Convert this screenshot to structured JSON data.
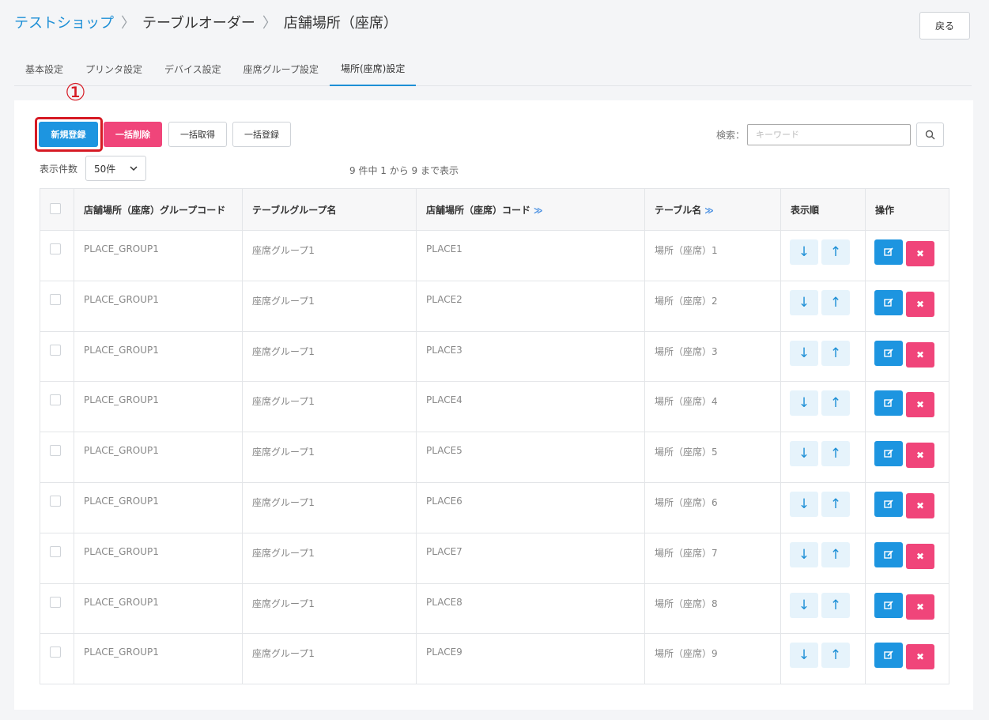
{
  "breadcrumb": {
    "shop": "テストショップ",
    "sep": ">",
    "section": "テーブルオーダー",
    "current": "店舗場所（座席）"
  },
  "header": {
    "back_label": "戻る"
  },
  "tabs": [
    {
      "label": "基本設定"
    },
    {
      "label": "プリンタ設定"
    },
    {
      "label": "デバイス設定"
    },
    {
      "label": "座席グループ設定"
    },
    {
      "label": "場所(座席)設定"
    }
  ],
  "annotation": "①",
  "toolbar": {
    "new_label": "新規登録",
    "bulk_delete_label": "一括削除",
    "bulk_get_label": "一括取得",
    "bulk_register_label": "一括登録",
    "search_label": "検索：",
    "search_placeholder": "キーワード",
    "count_label": "表示件数",
    "count_value": "50件",
    "info": "9 件中 1 から 9 まで表示"
  },
  "table": {
    "headers": {
      "group_code": "店舗場所（座席）グループコード",
      "group_name": "テーブルグループ名",
      "place_code": "店舗場所（座席）コード",
      "table_name": "テーブル名",
      "order": "表示順",
      "ops": "操作"
    },
    "rows": [
      {
        "group_code": "PLACE_GROUP1",
        "group_name": "座席グループ1",
        "place_code": "PLACE1",
        "table_name": "場所（座席）1"
      },
      {
        "group_code": "PLACE_GROUP1",
        "group_name": "座席グループ1",
        "place_code": "PLACE2",
        "table_name": "場所（座席）2"
      },
      {
        "group_code": "PLACE_GROUP1",
        "group_name": "座席グループ1",
        "place_code": "PLACE3",
        "table_name": "場所（座席）3"
      },
      {
        "group_code": "PLACE_GROUP1",
        "group_name": "座席グループ1",
        "place_code": "PLACE4",
        "table_name": "場所（座席）4"
      },
      {
        "group_code": "PLACE_GROUP1",
        "group_name": "座席グループ1",
        "place_code": "PLACE5",
        "table_name": "場所（座席）5"
      },
      {
        "group_code": "PLACE_GROUP1",
        "group_name": "座席グループ1",
        "place_code": "PLACE6",
        "table_name": "場所（座席）6"
      },
      {
        "group_code": "PLACE_GROUP1",
        "group_name": "座席グループ1",
        "place_code": "PLACE7",
        "table_name": "場所（座席）7"
      },
      {
        "group_code": "PLACE_GROUP1",
        "group_name": "座席グループ1",
        "place_code": "PLACE8",
        "table_name": "場所（座席）8"
      },
      {
        "group_code": "PLACE_GROUP1",
        "group_name": "座席グループ1",
        "place_code": "PLACE9",
        "table_name": "場所（座席）9"
      }
    ]
  },
  "icons": {
    "sort": "double-chevron-down-icon",
    "down": "arrow-down-icon",
    "up": "arrow-up-icon",
    "edit": "edit-icon",
    "remove": "close-icon",
    "search": "search-icon"
  },
  "colors": {
    "primary": "#1d95e0",
    "danger": "#f0457a",
    "annotation": "#d61a24"
  }
}
